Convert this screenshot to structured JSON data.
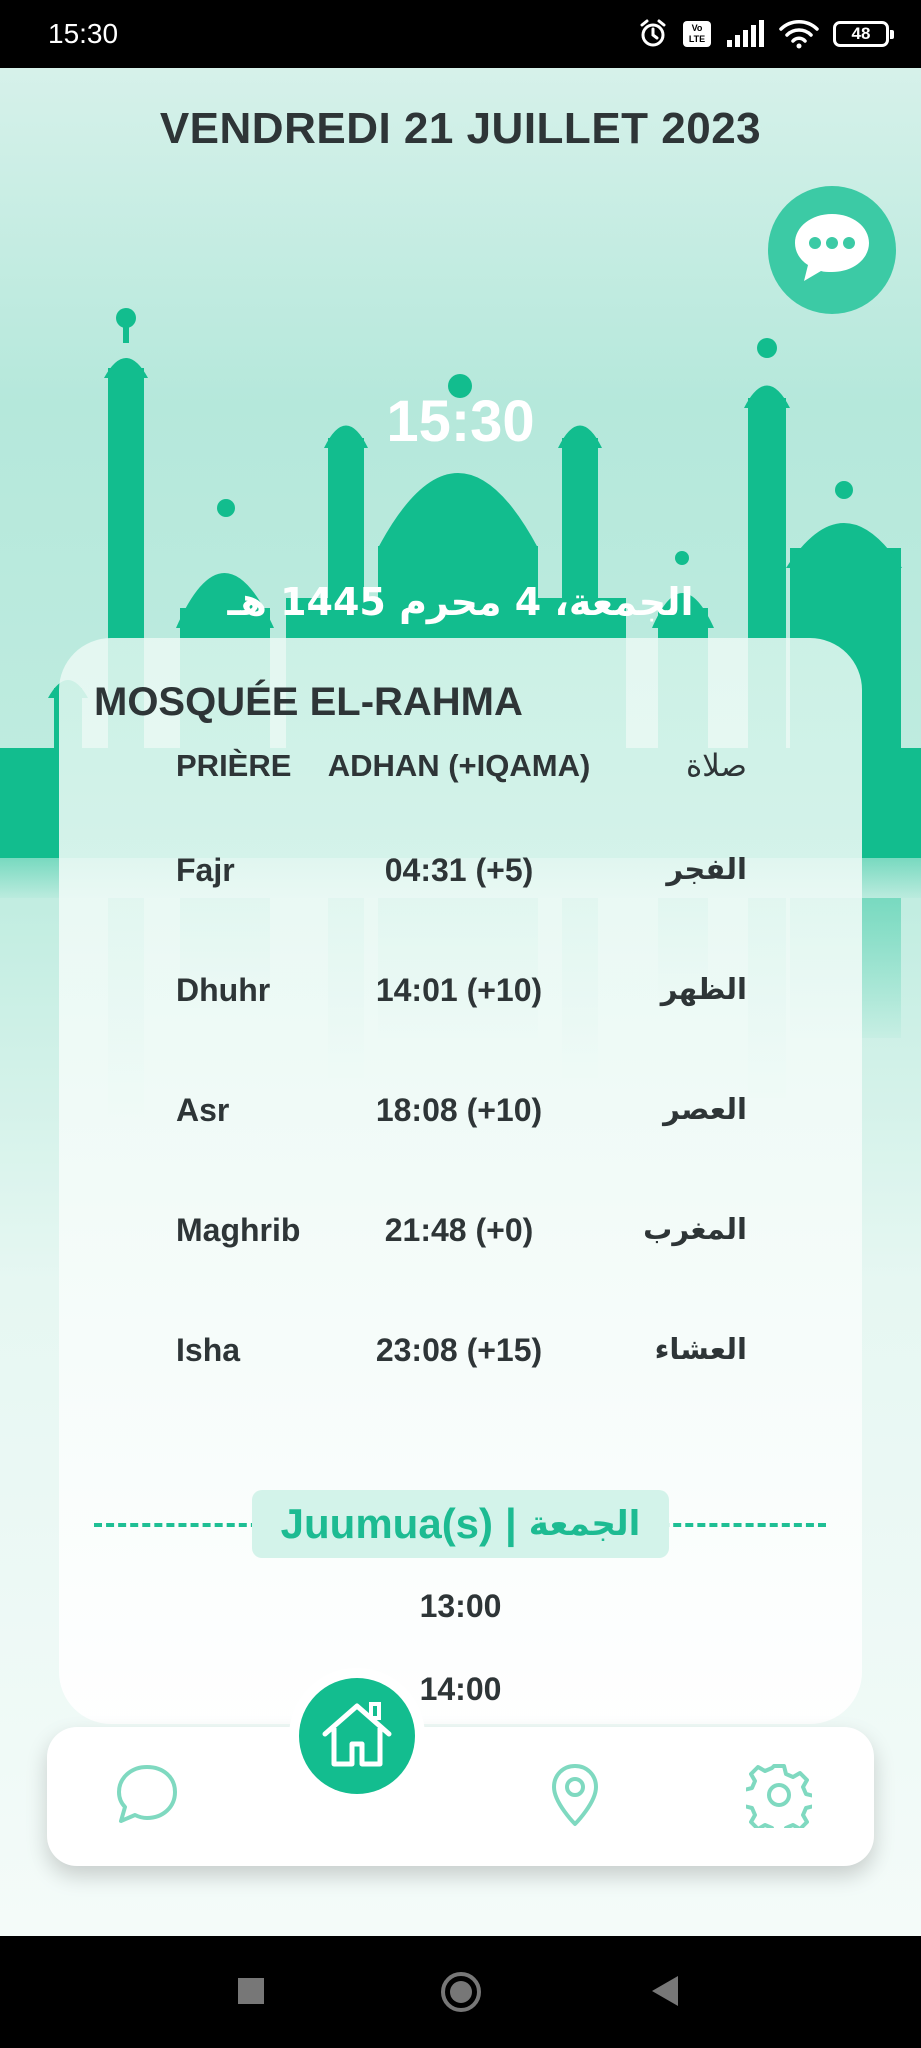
{
  "status_bar": {
    "time": "15:30",
    "volte_text": "Vo LTE",
    "battery": "48"
  },
  "header": {
    "date": "VENDREDI 21 JUILLET 2023",
    "clock": "15:30",
    "hijri_date": "الجمعة، 4 محرم 1445 هـ"
  },
  "card": {
    "mosque_name": "MOSQUÉE EL-RAHMA",
    "headers": {
      "prayer": "PRIÈRE",
      "adhan": "ADHAN (+IQAMA)",
      "arabic": "صلاة"
    },
    "prayers": [
      {
        "name": "Fajr",
        "time": "04:31 (+5)",
        "arabic": "الفجر"
      },
      {
        "name": "Dhuhr",
        "time": "14:01 (+10)",
        "arabic": "الظهر"
      },
      {
        "name": "Asr",
        "time": "18:08 (+10)",
        "arabic": "العصر"
      },
      {
        "name": "Maghrib",
        "time": "21:48 (+0)",
        "arabic": "المغرب"
      },
      {
        "name": "Isha",
        "time": "23:08 (+15)",
        "arabic": "العشاء"
      }
    ],
    "juumua": {
      "label": "Juumua(s)",
      "separator": "|",
      "arabic": "الجمعة",
      "times": [
        "13:00",
        "14:00"
      ]
    }
  },
  "nav": {
    "items": [
      "chat-icon",
      "home-icon",
      "location-pin-icon",
      "gear-icon"
    ],
    "active": "home"
  },
  "colors": {
    "accent": "#13bd8f",
    "accent_light": "#3ccaa5",
    "text": "#2e3537",
    "nav_icon": "#7fd9c0"
  }
}
